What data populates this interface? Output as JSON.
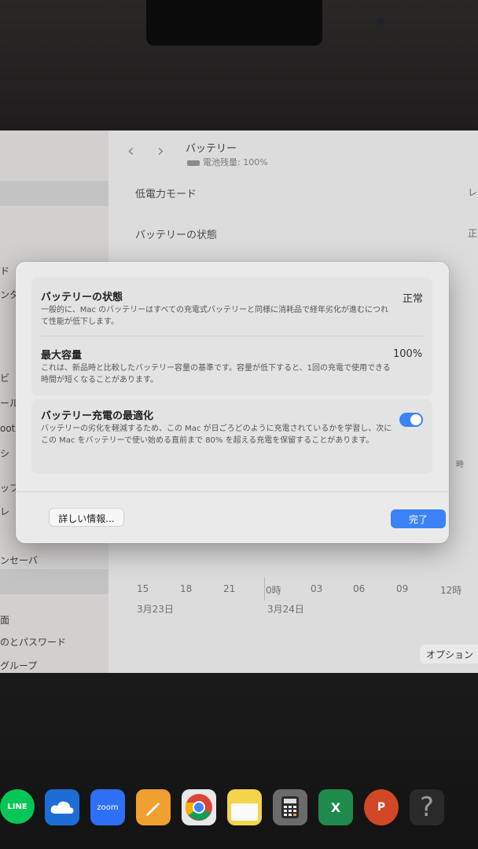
{
  "window": {
    "title": "バッテリー",
    "subtitle": "電池残量: 100%"
  },
  "sidebar": {
    "items": [
      "ド",
      "ンタ",
      "ビ",
      "ール",
      "ootl",
      "シ",
      "ッフ",
      "レ",
      "ンセーバ",
      "面",
      "のとパスワード",
      "グループ"
    ]
  },
  "main": {
    "rows": [
      {
        "label": "低電力モード",
        "value": "レ"
      },
      {
        "label": "バッテリーの状態",
        "value": "正"
      }
    ],
    "chart_axis": {
      "x_ticks": [
        "15",
        "18",
        "21",
        "0時",
        "03",
        "06",
        "09",
        "12時"
      ],
      "dates": [
        "3月23日",
        "3月24日"
      ],
      "side_label": "時"
    },
    "options_label": "オプション"
  },
  "modal": {
    "battery_health": {
      "title": "バッテリーの状態",
      "desc": "一般的に、Mac のバッテリーはすべての充電式バッテリーと同様に消耗品で経年劣化が進むにつれて性能が低下します。",
      "value": "正常"
    },
    "max_capacity": {
      "title": "最大容量",
      "desc": "これは、新品時と比較したバッテリー容量の基準です。容量が低下すると、1回の充電で使用できる時間が短くなることがあります。",
      "value": "100%"
    },
    "optimized_charging": {
      "title": "バッテリー充電の最適化",
      "desc": "バッテリーの劣化を軽減するため、この Mac が日ごろどのように充電されているかを学習し、次にこの Mac をバッテリーで使い始める直前まで 80% を超える充電を保留することがあります。",
      "enabled": true
    },
    "details_label": "詳しい情報...",
    "done_label": "完了"
  },
  "dock": {
    "icons": [
      {
        "name": "line-icon",
        "label": "LINE",
        "color": "#06c755"
      },
      {
        "name": "onedrive-icon",
        "label": "",
        "color": "#1c6ed6"
      },
      {
        "name": "zoom-icon",
        "label": "zoom",
        "color": "#2d6ff7"
      },
      {
        "name": "pencil-icon",
        "label": "",
        "color": "#f0a030"
      },
      {
        "name": "chrome-icon",
        "label": "",
        "color": "#e8e8e8"
      },
      {
        "name": "notes-icon",
        "label": "",
        "color": "#f3d44a"
      },
      {
        "name": "calculator-icon",
        "label": "",
        "color": "#6b6b6b"
      },
      {
        "name": "excel-icon",
        "label": "X",
        "color": "#1f8a4c"
      },
      {
        "name": "powerpoint-icon",
        "label": "P",
        "color": "#d24726"
      },
      {
        "name": "help-icon",
        "label": "?",
        "color": "#2a2a2a"
      }
    ]
  },
  "colors": {
    "accent": "#3b82f6"
  }
}
